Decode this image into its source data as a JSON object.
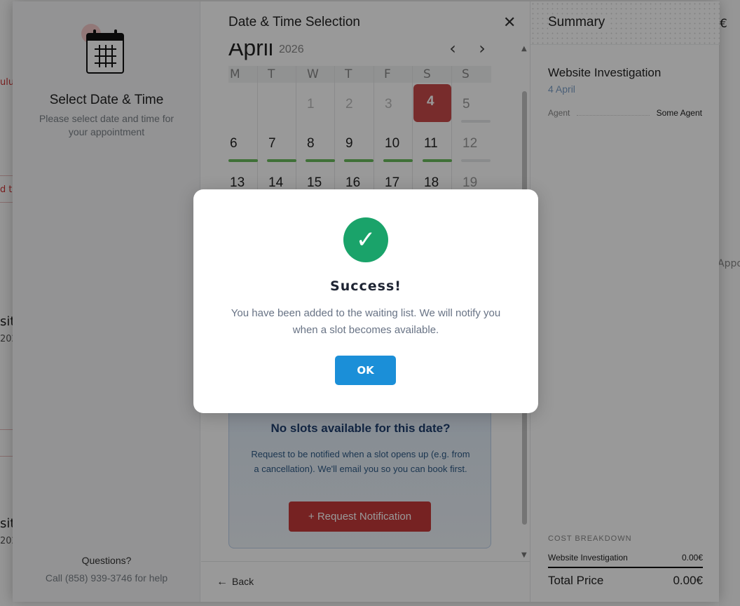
{
  "background": {
    "left_fragments": [
      "ulu",
      "d t",
      "sit",
      "202",
      "sit",
      "202"
    ],
    "right_fragments": [
      "€",
      "Appo"
    ]
  },
  "sidebar": {
    "title": "Select Date & Time",
    "subtitle": "Please select date and time for your appointment",
    "questions": "Questions?",
    "call": "Call (858) 939-3746 for help"
  },
  "main": {
    "title": "Date & Time Selection",
    "month": "April",
    "year": "2026",
    "weekdays": [
      "M",
      "T",
      "W",
      "T",
      "F",
      "S",
      "S"
    ],
    "row1": [
      "1",
      "2",
      "3",
      "4",
      "5"
    ],
    "row2": [
      "6",
      "7",
      "8",
      "9",
      "10",
      "11",
      "12"
    ],
    "row3": [
      "13",
      "14",
      "15",
      "16",
      "17",
      "18",
      "19"
    ],
    "no_slots": {
      "title": "No slots available for this date?",
      "text": "Request to be notified when a slot opens up (e.g. from a cancellation). We'll email you so you can book first.",
      "button": "Request Notification"
    },
    "back_label": "Back"
  },
  "summary": {
    "title": "Summary",
    "service": "Website Investigation",
    "date": "4 April",
    "agent_label": "Agent",
    "agent_value": "Some Agent",
    "cost_heading": "COST BREAKDOWN",
    "cost_item": "Website Investigation",
    "cost_value": "0.00€",
    "total_label": "Total Price",
    "total_value": "0.00€"
  },
  "dialog": {
    "title": "Success!",
    "message": "You have been added to the waiting list. We will notify you when a slot becomes available.",
    "ok_label": "OK"
  },
  "colors": {
    "accent_blue": "#1b8fd8",
    "success_green": "#1aa36a",
    "selected_red": "#c84a4a",
    "available_bar": "#6abb5c"
  }
}
